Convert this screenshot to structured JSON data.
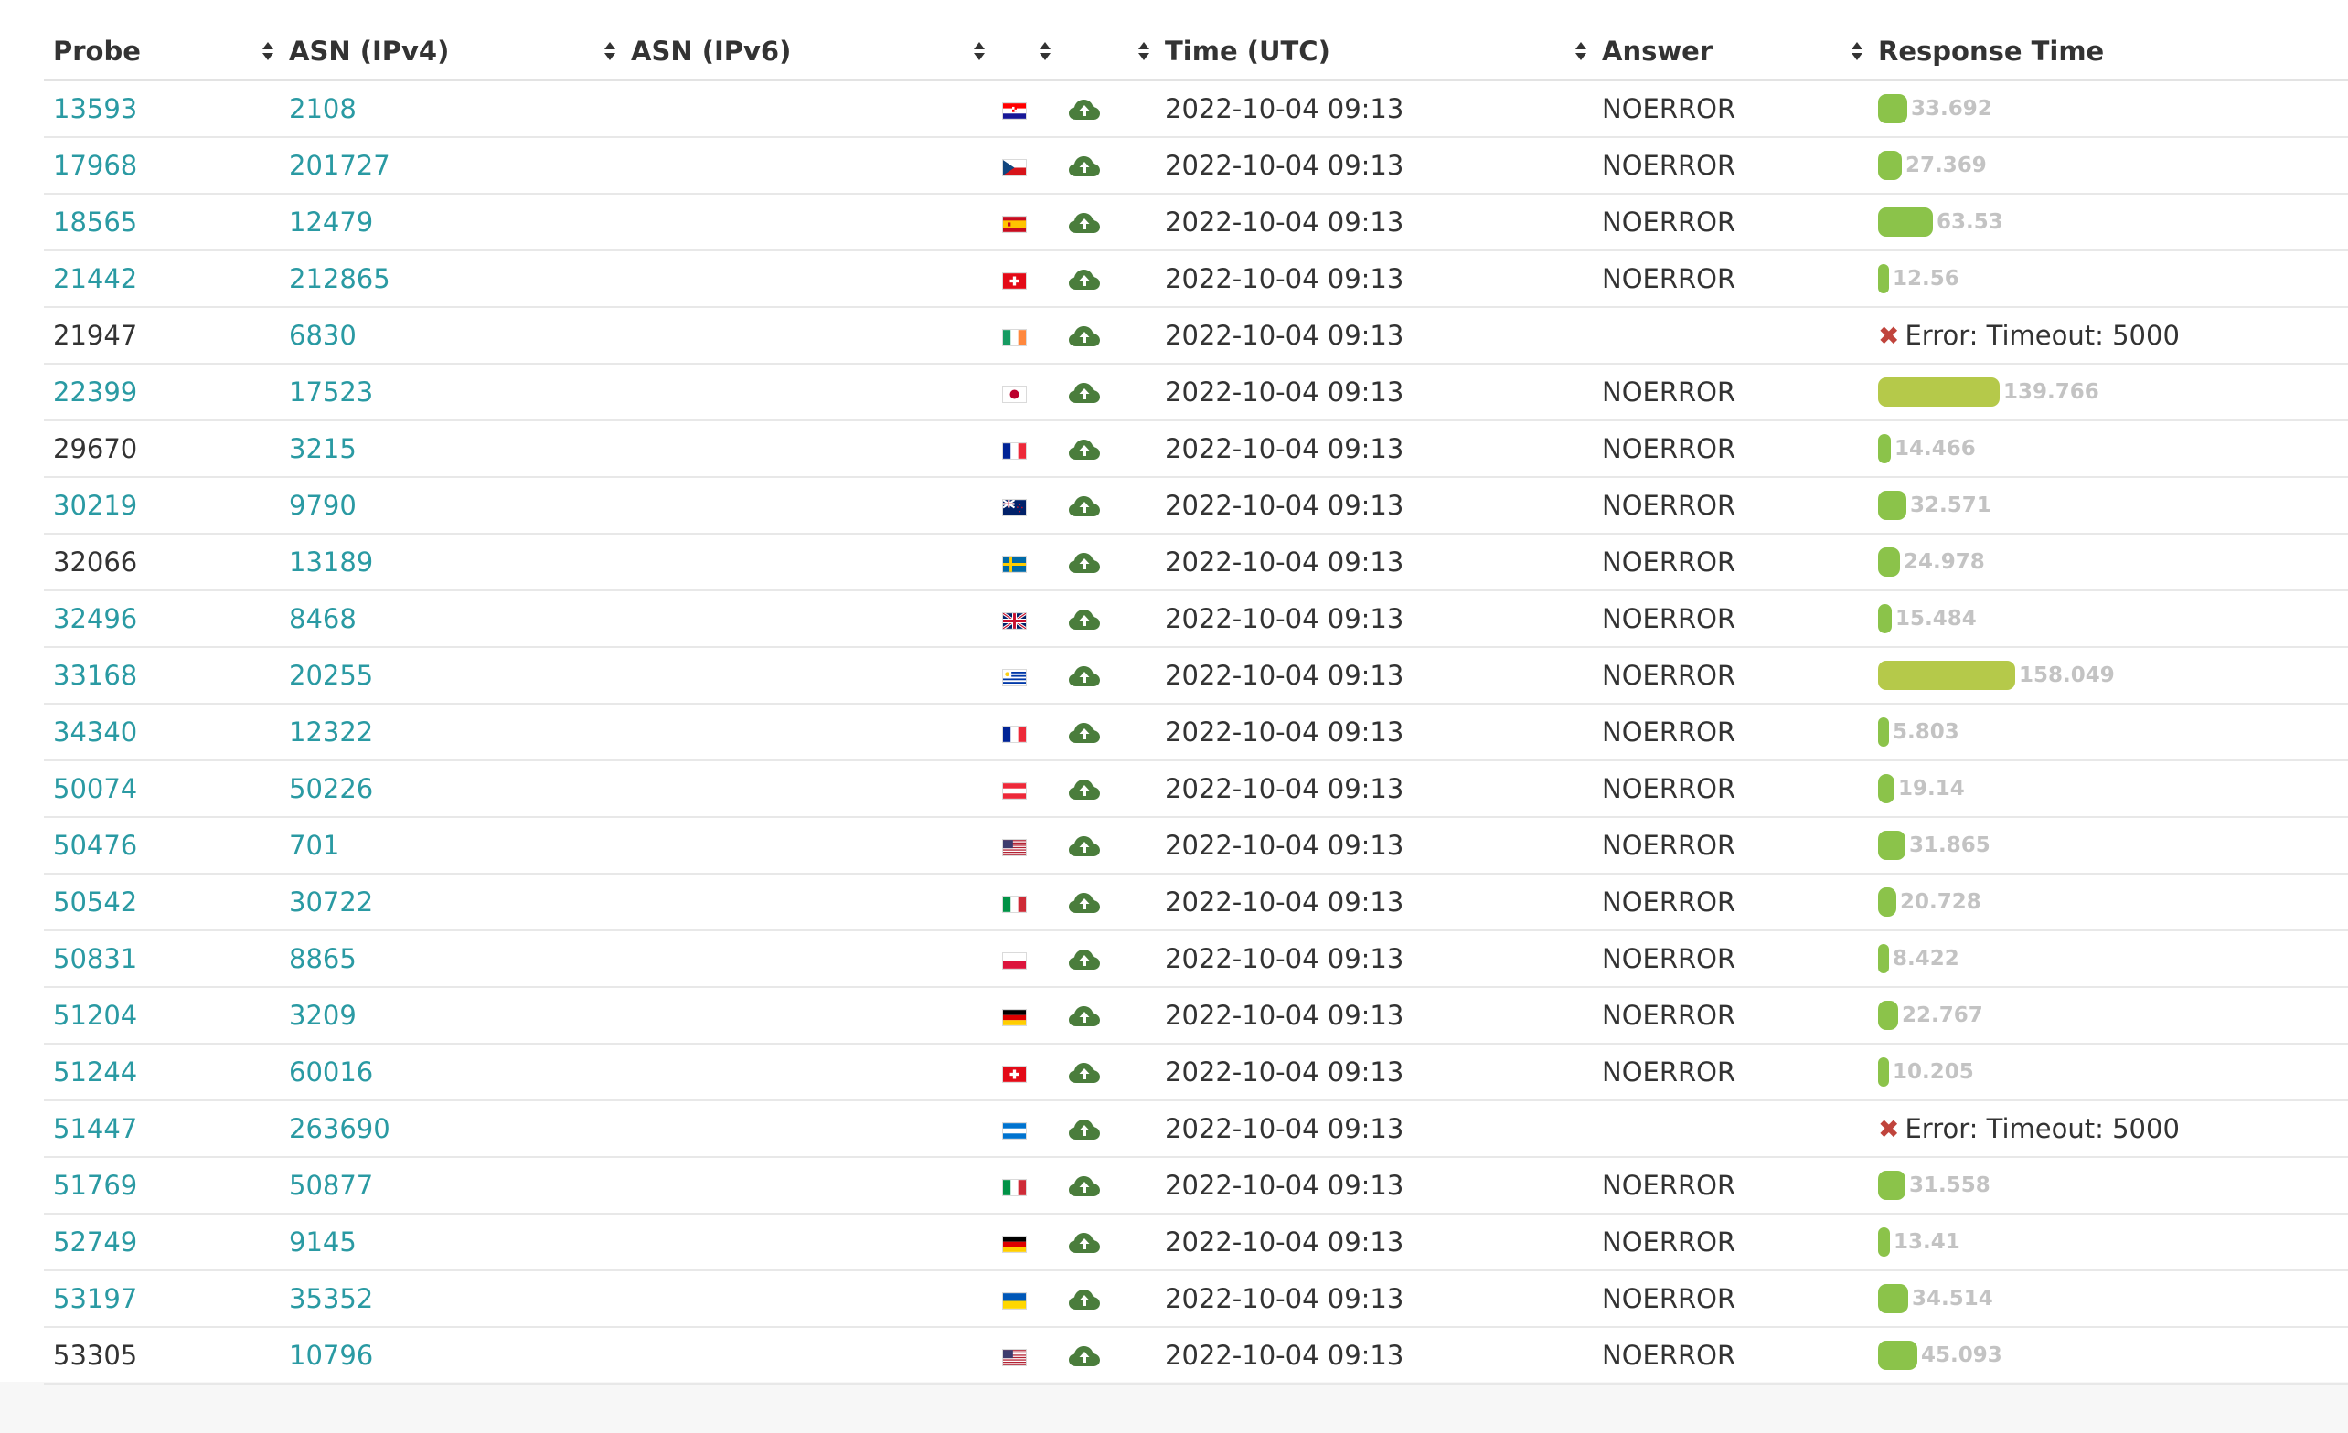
{
  "header": {
    "probe": "Probe",
    "asn_v4": "ASN (IPv4)",
    "asn_v6": "ASN (IPv6)",
    "flag": "",
    "status": "",
    "time": "Time (UTC)",
    "answer": "Answer",
    "response_time": "Response Time"
  },
  "colors": {
    "link": "#2a9aa3",
    "bar_fast": "#8bc34a",
    "bar_slow": "#b5c94a",
    "cloud_icon": "#4a7d3c",
    "error_icon": "#c0443c"
  },
  "rows": [
    {
      "probe": "13593",
      "probe_link": true,
      "asn4": "2108",
      "asn6": "",
      "country": "HR",
      "flag_icon": "flag-croatia",
      "time": "2022-10-04 09:13",
      "answer": "NOERROR",
      "rt": "33.692",
      "rt_value": 33.692,
      "error": ""
    },
    {
      "probe": "17968",
      "probe_link": true,
      "asn4": "201727",
      "asn6": "",
      "country": "CZ",
      "flag_icon": "flag-czechia",
      "time": "2022-10-04 09:13",
      "answer": "NOERROR",
      "rt": "27.369",
      "rt_value": 27.369,
      "error": ""
    },
    {
      "probe": "18565",
      "probe_link": true,
      "asn4": "12479",
      "asn6": "",
      "country": "ES",
      "flag_icon": "flag-spain",
      "time": "2022-10-04 09:13",
      "answer": "NOERROR",
      "rt": "63.53",
      "rt_value": 63.53,
      "error": ""
    },
    {
      "probe": "21442",
      "probe_link": true,
      "asn4": "212865",
      "asn6": "",
      "country": "CH",
      "flag_icon": "flag-switzerland",
      "time": "2022-10-04 09:13",
      "answer": "NOERROR",
      "rt": "12.56",
      "rt_value": 12.56,
      "error": ""
    },
    {
      "probe": "21947",
      "probe_link": false,
      "asn4": "6830",
      "asn6": "",
      "country": "IE",
      "flag_icon": "flag-ireland",
      "time": "2022-10-04 09:13",
      "answer": "",
      "rt": "",
      "rt_value": null,
      "error": "Error: Timeout: 5000"
    },
    {
      "probe": "22399",
      "probe_link": true,
      "asn4": "17523",
      "asn6": "",
      "country": "JP",
      "flag_icon": "flag-japan",
      "time": "2022-10-04 09:13",
      "answer": "NOERROR",
      "rt": "139.766",
      "rt_value": 139.766,
      "error": ""
    },
    {
      "probe": "29670",
      "probe_link": false,
      "asn4": "3215",
      "asn6": "",
      "country": "FR",
      "flag_icon": "flag-france",
      "time": "2022-10-04 09:13",
      "answer": "NOERROR",
      "rt": "14.466",
      "rt_value": 14.466,
      "error": ""
    },
    {
      "probe": "30219",
      "probe_link": true,
      "asn4": "9790",
      "asn6": "",
      "country": "NZ",
      "flag_icon": "flag-new-zealand",
      "time": "2022-10-04 09:13",
      "answer": "NOERROR",
      "rt": "32.571",
      "rt_value": 32.571,
      "error": ""
    },
    {
      "probe": "32066",
      "probe_link": false,
      "asn4": "13189",
      "asn6": "",
      "country": "SE",
      "flag_icon": "flag-sweden",
      "time": "2022-10-04 09:13",
      "answer": "NOERROR",
      "rt": "24.978",
      "rt_value": 24.978,
      "error": ""
    },
    {
      "probe": "32496",
      "probe_link": true,
      "asn4": "8468",
      "asn6": "",
      "country": "GB",
      "flag_icon": "flag-united-kingdom",
      "time": "2022-10-04 09:13",
      "answer": "NOERROR",
      "rt": "15.484",
      "rt_value": 15.484,
      "error": ""
    },
    {
      "probe": "33168",
      "probe_link": true,
      "asn4": "20255",
      "asn6": "",
      "country": "UY",
      "flag_icon": "flag-uruguay",
      "time": "2022-10-04 09:13",
      "answer": "NOERROR",
      "rt": "158.049",
      "rt_value": 158.049,
      "error": ""
    },
    {
      "probe": "34340",
      "probe_link": true,
      "asn4": "12322",
      "asn6": "",
      "country": "FR",
      "flag_icon": "flag-france",
      "time": "2022-10-04 09:13",
      "answer": "NOERROR",
      "rt": "5.803",
      "rt_value": 5.803,
      "error": ""
    },
    {
      "probe": "50074",
      "probe_link": true,
      "asn4": "50226",
      "asn6": "",
      "country": "AT",
      "flag_icon": "flag-austria",
      "time": "2022-10-04 09:13",
      "answer": "NOERROR",
      "rt": "19.14",
      "rt_value": 19.14,
      "error": ""
    },
    {
      "probe": "50476",
      "probe_link": true,
      "asn4": "701",
      "asn6": "",
      "country": "US",
      "flag_icon": "flag-united-states",
      "time": "2022-10-04 09:13",
      "answer": "NOERROR",
      "rt": "31.865",
      "rt_value": 31.865,
      "error": ""
    },
    {
      "probe": "50542",
      "probe_link": true,
      "asn4": "30722",
      "asn6": "",
      "country": "IT",
      "flag_icon": "flag-italy",
      "time": "2022-10-04 09:13",
      "answer": "NOERROR",
      "rt": "20.728",
      "rt_value": 20.728,
      "error": ""
    },
    {
      "probe": "50831",
      "probe_link": true,
      "asn4": "8865",
      "asn6": "",
      "country": "PL",
      "flag_icon": "flag-poland",
      "time": "2022-10-04 09:13",
      "answer": "NOERROR",
      "rt": "8.422",
      "rt_value": 8.422,
      "error": ""
    },
    {
      "probe": "51204",
      "probe_link": true,
      "asn4": "3209",
      "asn6": "",
      "country": "DE",
      "flag_icon": "flag-germany",
      "time": "2022-10-04 09:13",
      "answer": "NOERROR",
      "rt": "22.767",
      "rt_value": 22.767,
      "error": ""
    },
    {
      "probe": "51244",
      "probe_link": true,
      "asn4": "60016",
      "asn6": "",
      "country": "CH",
      "flag_icon": "flag-switzerland",
      "time": "2022-10-04 09:13",
      "answer": "NOERROR",
      "rt": "10.205",
      "rt_value": 10.205,
      "error": ""
    },
    {
      "probe": "51447",
      "probe_link": true,
      "asn4": "263690",
      "asn6": "",
      "country": "HN",
      "flag_icon": "flag-honduras",
      "time": "2022-10-04 09:13",
      "answer": "",
      "rt": "",
      "rt_value": null,
      "error": "Error: Timeout: 5000"
    },
    {
      "probe": "51769",
      "probe_link": true,
      "asn4": "50877",
      "asn6": "",
      "country": "IT",
      "flag_icon": "flag-italy",
      "time": "2022-10-04 09:13",
      "answer": "NOERROR",
      "rt": "31.558",
      "rt_value": 31.558,
      "error": ""
    },
    {
      "probe": "52749",
      "probe_link": true,
      "asn4": "9145",
      "asn6": "",
      "country": "DE",
      "flag_icon": "flag-germany",
      "time": "2022-10-04 09:13",
      "answer": "NOERROR",
      "rt": "13.41",
      "rt_value": 13.41,
      "error": ""
    },
    {
      "probe": "53197",
      "probe_link": true,
      "asn4": "35352",
      "asn6": "",
      "country": "UA",
      "flag_icon": "flag-ukraine",
      "time": "2022-10-04 09:13",
      "answer": "NOERROR",
      "rt": "34.514",
      "rt_value": 34.514,
      "error": ""
    },
    {
      "probe": "53305",
      "probe_link": false,
      "asn4": "10796",
      "asn6": "",
      "country": "US",
      "flag_icon": "flag-united-states",
      "time": "2022-10-04 09:13",
      "answer": "NOERROR",
      "rt": "45.093",
      "rt_value": 45.093,
      "error": ""
    }
  ]
}
